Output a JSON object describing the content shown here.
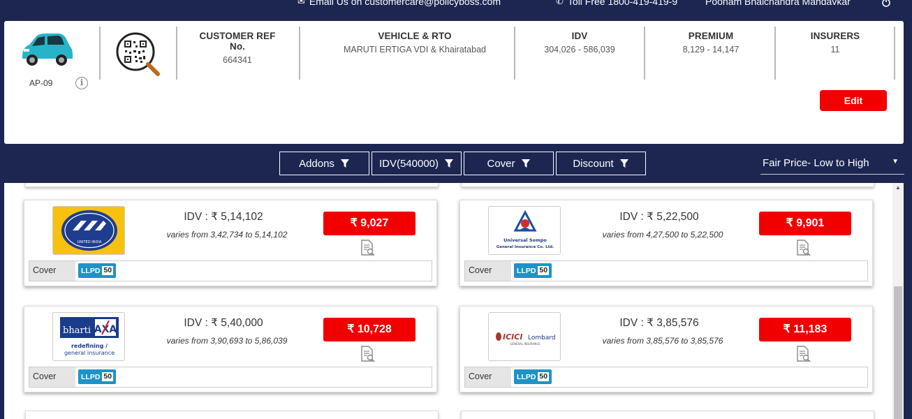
{
  "topbar": {
    "email_text": "Email Us on customercare@policyboss.com",
    "tollfree_text": "Toll Free 1800-419-419-9",
    "user_name": "Poonam Bhalchandra Mandavkar"
  },
  "summary": {
    "rto_code": "AP-09",
    "columns": [
      {
        "header": "CUSTOMER REF No.",
        "value": "664341"
      },
      {
        "header": "VEHICLE & RTO",
        "value": "MARUTI ERTIGA VDI & Khairatabad"
      },
      {
        "header": "IDV",
        "value": "304,026 - 586,039"
      },
      {
        "header": "PREMIUM",
        "value": "8,129 - 14,147"
      },
      {
        "header": "INSURERS",
        "value": "11"
      }
    ],
    "edit_label": "Edit"
  },
  "filters": {
    "addons": "Addons",
    "idv": "IDV(540000)",
    "cover": "Cover",
    "discount": "Discount",
    "sort_selected": "Fair Price- Low to High"
  },
  "cards": [
    {
      "insurer": "United India",
      "logo_text": "UNITED INDIA",
      "idv": "IDV : ₹ 5,14,102",
      "varies": "varies from 3,42,734 to 5,14,102",
      "premium": "₹ 9,027",
      "cover_label": "Cover",
      "badge": "LLPD",
      "badge_value": "50"
    },
    {
      "insurer": "Universal Sompo",
      "logo_text": "Universal Sompo General Insurance Co. Ltd.",
      "idv": "IDV : ₹ 5,22,500",
      "varies": "varies from 4,27,500 to 5,22,500",
      "premium": "₹ 9,901",
      "cover_label": "Cover",
      "badge": "LLPD",
      "badge_value": "50"
    },
    {
      "insurer": "Bharti AXA",
      "logo_text_1": "bharti",
      "logo_text_2": "AXA",
      "logo_tag_1": "redefining /",
      "logo_tag_2": "general insurance",
      "idv": "IDV : ₹ 5,40,000",
      "varies": "varies from 3,90,693 to 5,86,039",
      "premium": "₹ 10,728",
      "cover_label": "Cover",
      "badge": "LLPD",
      "badge_value": "50"
    },
    {
      "insurer": "ICICI Lombard",
      "logo_text_1": "ICICI",
      "logo_text_2": "Lombard",
      "logo_tag": "GENERAL INSURANCE",
      "idv": "IDV : ₹ 3,85,576",
      "varies": "varies from 3,85,576 to 3,85,576",
      "premium": "₹ 11,183",
      "cover_label": "Cover",
      "badge": "LLPD",
      "badge_value": "50"
    }
  ],
  "colors": {
    "navy": "#1c2651",
    "red_button": "#f20000",
    "badge_blue": "#1d93c8"
  }
}
